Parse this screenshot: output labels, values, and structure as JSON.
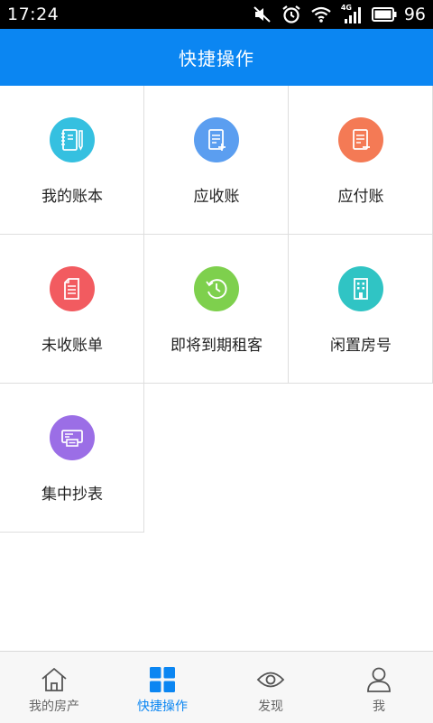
{
  "status_bar": {
    "time": "17:24",
    "network": "4G",
    "battery": "96"
  },
  "header": {
    "title": "快捷操作"
  },
  "grid": {
    "items": [
      {
        "label": "我的账本",
        "icon": "notebook-icon",
        "color": "#35c0e0"
      },
      {
        "label": "应收账",
        "icon": "receivable-doc-icon",
        "color": "#5b9ef0"
      },
      {
        "label": "应付账",
        "icon": "payable-doc-icon",
        "color": "#f47a55"
      },
      {
        "label": "未收账单",
        "icon": "bill-doc-icon",
        "color": "#f25b60"
      },
      {
        "label": "即将到期租客",
        "icon": "clock-icon",
        "color": "#7ed04d"
      },
      {
        "label": "闲置房号",
        "icon": "building-icon",
        "color": "#30c4c4"
      },
      {
        "label": "集中抄表",
        "icon": "meter-icon",
        "color": "#9b6ee6"
      }
    ]
  },
  "tabbar": {
    "active_color": "#0b86f2",
    "tabs": [
      {
        "label": "我的房产",
        "icon": "home-icon",
        "active": false
      },
      {
        "label": "快捷操作",
        "icon": "grid-icon",
        "active": true
      },
      {
        "label": "发现",
        "icon": "eye-icon",
        "active": false
      },
      {
        "label": "我",
        "icon": "user-icon",
        "active": false
      }
    ]
  }
}
